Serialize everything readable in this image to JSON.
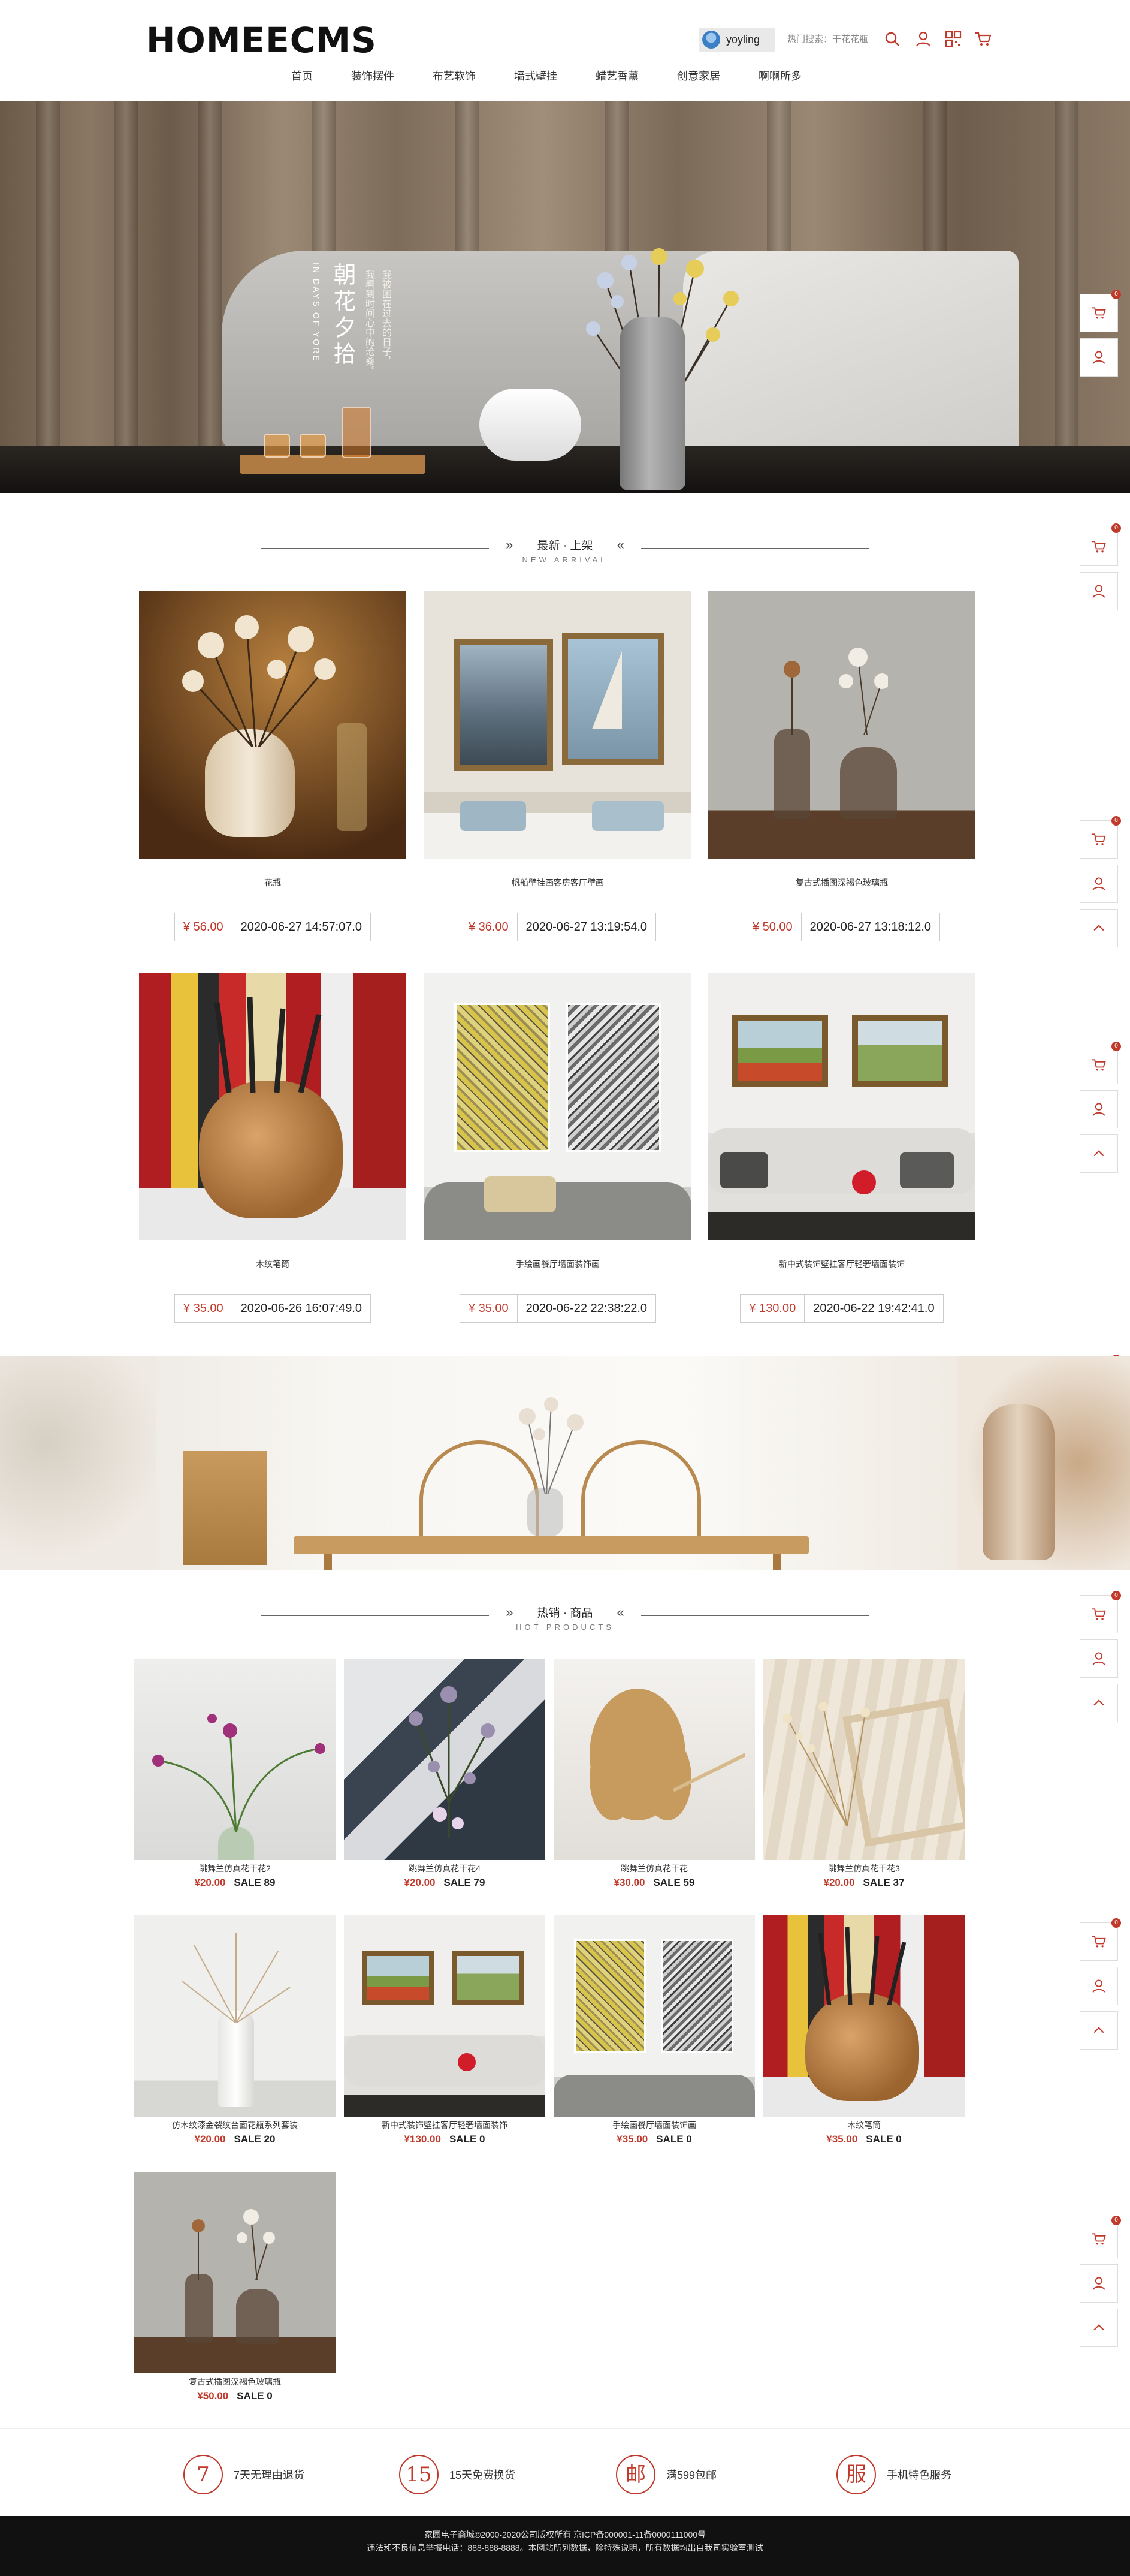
{
  "header": {
    "logo": "HOMEECMS",
    "user": "yoyling",
    "search_placeholder": "热门搜索：干花花瓶",
    "nav": [
      "首页",
      "装饰摆件",
      "布艺软饰",
      "墙式壁挂",
      "蜡艺香薰",
      "创意家居",
      "啊啊所多"
    ]
  },
  "banner": {
    "title": "朝花夕拾",
    "title_en": "IN DAYS OF YORE",
    "lines": [
      "我被困在过去的日子，",
      "我看到时间心中的沧桑。"
    ]
  },
  "side_buttons": {
    "badge": "0"
  },
  "new_arrival": {
    "title_cn": "最新 · 上架",
    "title_en": "NEW ARRIVAL",
    "items": [
      {
        "name": "花瓶",
        "price": "¥ 56.00",
        "date": "2020-06-27 14:57:07.0"
      },
      {
        "name": "帆船壁挂画客房客厅壁画",
        "price": "¥ 36.00",
        "date": "2020-06-27 13:19:54.0"
      },
      {
        "name": "复古式插图深褐色玻璃瓶",
        "price": "¥ 50.00",
        "date": "2020-06-27 13:18:12.0"
      },
      {
        "name": "木纹笔筒",
        "price": "¥ 35.00",
        "date": "2020-06-26 16:07:49.0"
      },
      {
        "name": "手绘画餐厅墙面装饰画",
        "price": "¥ 35.00",
        "date": "2020-06-22 22:38:22.0"
      },
      {
        "name": "新中式装饰壁挂客厅轻奢墙面装饰",
        "price": "¥ 130.00",
        "date": "2020-06-22 19:42:41.0"
      }
    ]
  },
  "hot_products": {
    "title_cn": "热销 · 商品",
    "title_en": "HOT PRODUCTS",
    "items": [
      {
        "name": "跳舞兰仿真花干花2",
        "price": "¥20.00",
        "sale": "SALE 89"
      },
      {
        "name": "跳舞兰仿真花干花4",
        "price": "¥20.00",
        "sale": "SALE 79"
      },
      {
        "name": "跳舞兰仿真花干花",
        "price": "¥30.00",
        "sale": "SALE 59"
      },
      {
        "name": "跳舞兰仿真花干花3",
        "price": "¥20.00",
        "sale": "SALE 37"
      },
      {
        "name": "仿木纹漆金裂纹台面花瓶系列套装",
        "price": "¥20.00",
        "sale": "SALE 20"
      },
      {
        "name": "新中式装饰壁挂客厅轻奢墙面装饰",
        "price": "¥130.00",
        "sale": "SALE 0"
      },
      {
        "name": "手绘画餐厅墙面装饰画",
        "price": "¥35.00",
        "sale": "SALE 0"
      },
      {
        "name": "木纹笔筒",
        "price": "¥35.00",
        "sale": "SALE 0"
      },
      {
        "name": "复古式插图深褐色玻璃瓶",
        "price": "¥50.00",
        "sale": "SALE 0"
      }
    ]
  },
  "services": [
    {
      "icon": "7",
      "text": "7天无理由退货"
    },
    {
      "icon": "15",
      "text": "15天免费换货"
    },
    {
      "icon": "邮",
      "text": "满599包邮"
    },
    {
      "icon": "服",
      "text": "手机特色服务"
    }
  ],
  "footer": {
    "line1": "家园电子商城©2000-2020公司版权所有 京ICP备000001-11备0000111000号",
    "line2": "违法和不良信息举报电话：888-888-8888。本网站所列数据，除特殊说明，所有数据均出自我司实验室测试"
  }
}
